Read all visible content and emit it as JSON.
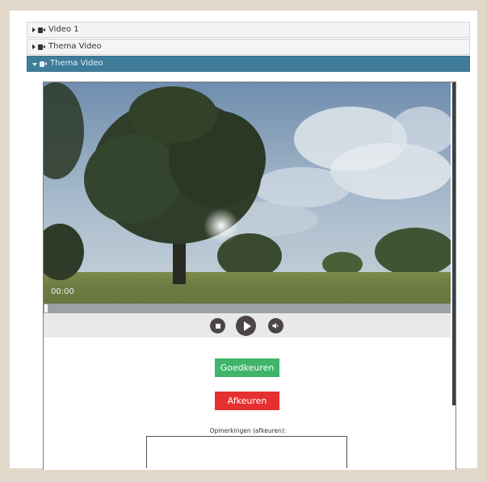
{
  "accordion": {
    "items": [
      {
        "label": "Video 1",
        "icon": "video-camera-icon",
        "expanded": false
      },
      {
        "label": "Thema Video",
        "icon": "video-camera-icon",
        "expanded": false
      },
      {
        "label": "Thema Video",
        "icon": "video-camera-icon",
        "expanded": true
      }
    ],
    "active_color": "#3f7c9a"
  },
  "player": {
    "timecode": "00:00",
    "progress": 0,
    "controls": [
      "stop-icon",
      "play-icon",
      "volume-icon"
    ]
  },
  "actions": {
    "approve_label": "Goedkeuren",
    "approve_color": "#3fb46a",
    "reject_label": "Afkeuren",
    "reject_color": "#e5302f"
  },
  "remarks": {
    "label": "Opmerkingen (afkeuren):",
    "value": ""
  }
}
